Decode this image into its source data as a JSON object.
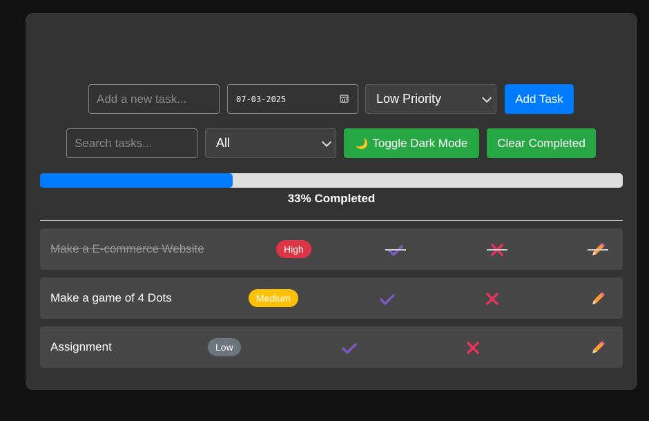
{
  "form": {
    "task_placeholder": "Add a new task...",
    "date_value": "07-03-2025",
    "priority_selected": "Low Priority",
    "add_button": "Add Task"
  },
  "filters": {
    "search_placeholder": "Search tasks...",
    "filter_selected": "All",
    "dark_mode_icon": "🌙",
    "dark_mode_button": "Toggle Dark Mode",
    "clear_button": "Clear Completed"
  },
  "progress": {
    "percent": 33,
    "label": "33% Completed"
  },
  "tasks": [
    {
      "text": "Make a E-commerce Website",
      "priority": "High",
      "completed": true
    },
    {
      "text": "Make a game of 4 Dots",
      "priority": "Medium",
      "completed": false
    },
    {
      "text": "Assignment",
      "priority": "Low",
      "completed": false
    }
  ],
  "colors": {
    "primary": "#007bff",
    "success": "#28a745",
    "danger": "#dc3545",
    "warning": "#ffc107",
    "secondary": "#6c757d",
    "check": "#7e57c2",
    "cross": "#e8345a",
    "pencil": "#ff9a3c"
  }
}
